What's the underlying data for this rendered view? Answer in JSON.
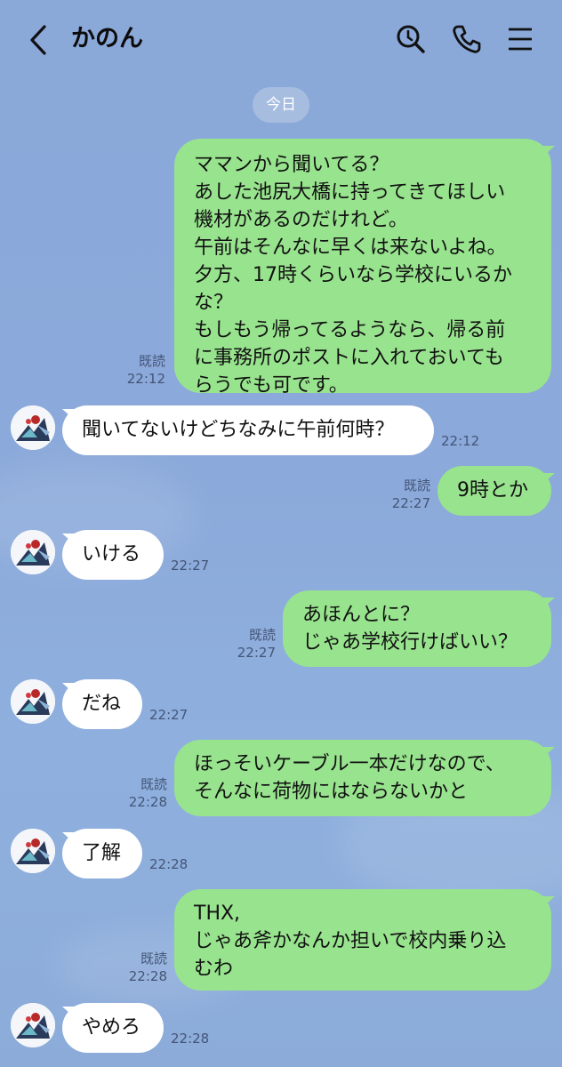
{
  "header": {
    "title": "かのん",
    "back_icon": "chevron-left-icon",
    "search_icon": "search-icon",
    "call_icon": "phone-icon",
    "menu_icon": "menu-icon"
  },
  "date_label": "今日",
  "messages": [
    {
      "side": "sent",
      "text": "ママンから聞いてる？\nあした池尻大橋に持ってきてほしい\n機材があるのだけれど。\n午前はそんなに早くは来ないよね。\n夕方、17時くらいなら学校にいるか\nな？\nもしもう帰ってるようなら、帰る前\nに事務所のポストに入れておいても\nらうでも可です。",
      "read": "既読",
      "time": "22:12"
    },
    {
      "side": "recv",
      "text": "聞いてないけどちなみに午前何時？",
      "time": "22:12"
    },
    {
      "side": "sent",
      "text": "9時とか",
      "read": "既読",
      "time": "22:27"
    },
    {
      "side": "recv",
      "text": "いける",
      "time": "22:27"
    },
    {
      "side": "sent",
      "text": "あほんとに？\nじゃあ学校行けばいい？",
      "read": "既読",
      "time": "22:27"
    },
    {
      "side": "recv",
      "text": "だね",
      "time": "22:27"
    },
    {
      "side": "sent",
      "text": "ほっそいケーブル一本だけなので、\nそんなに荷物にはならないかと",
      "read": "既読",
      "time": "22:28"
    },
    {
      "side": "recv",
      "text": "了解",
      "time": "22:28"
    },
    {
      "side": "sent",
      "text": "THX,\nじゃあ斧かなんか担いで校内乗り込\nむわ",
      "read": "既読",
      "time": "22:28"
    },
    {
      "side": "recv",
      "text": "やめろ",
      "time": "22:28"
    }
  ],
  "colors": {
    "background": "#8aa8d8",
    "sent_bubble": "#98e38e",
    "recv_bubble": "#ffffff"
  }
}
